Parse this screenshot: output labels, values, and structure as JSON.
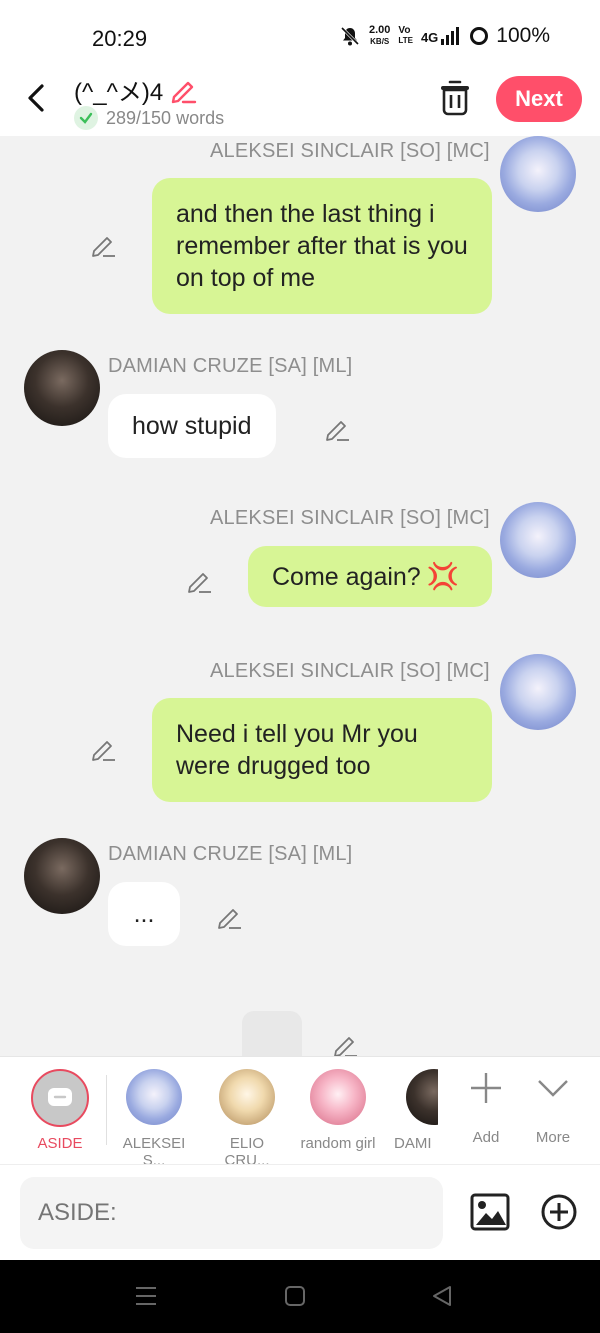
{
  "status": {
    "time": "20:29",
    "speed_value": "2.00",
    "speed_unit": "KB/S",
    "lte_top": "Vo",
    "lte_bottom": "LTE",
    "network": "4G",
    "battery": "100%"
  },
  "header": {
    "title": "(^_^メ)4",
    "word_count": "289/150 words",
    "next_label": "Next",
    "accent_color": "#ff4f6a"
  },
  "messages": [
    {
      "speaker": "ALEKSEI SINCLAIR [SO] [MC]",
      "side": "right",
      "text": "and then the last thing i remember after that is you on top of me"
    },
    {
      "speaker": "DAMIAN CRUZE [SA] [ML]",
      "side": "left",
      "text": "how stupid"
    },
    {
      "speaker": "ALEKSEI SINCLAIR [SO] [MC]",
      "side": "right",
      "text": "Come again?",
      "emoji": "💢"
    },
    {
      "speaker": "ALEKSEI SINCLAIR [SO] [MC]",
      "side": "right",
      "text": "Need i tell you Mr you were drugged too"
    },
    {
      "speaker": "DAMIAN CRUZE [SA] [ML]",
      "side": "left",
      "text": "..."
    },
    {
      "speaker": "",
      "side": "center",
      "text": "."
    }
  ],
  "characters": [
    {
      "label": "ASIDE",
      "active": true
    },
    {
      "label": "ALEKSEI S..."
    },
    {
      "label": "ELIO CRU..."
    },
    {
      "label": "random girl"
    },
    {
      "label": "DAMI"
    },
    {
      "label": "Add"
    },
    {
      "label": "More"
    }
  ],
  "composer": {
    "placeholder": "ASIDE:"
  },
  "icons": [
    "back-icon",
    "pencil-icon",
    "check-icon",
    "trash-icon",
    "edit-icon",
    "chat-bubble-icon",
    "plus-icon",
    "chevron-down-icon",
    "image-icon",
    "add-circle-icon",
    "menu-icon",
    "home-square-icon",
    "back-triangle-icon"
  ],
  "colors": {
    "my_bubble": "#d7f595",
    "their_bubble": "#ffffff",
    "chat_bg": "#f2f2f2",
    "aside_red": "#e84a5f"
  }
}
